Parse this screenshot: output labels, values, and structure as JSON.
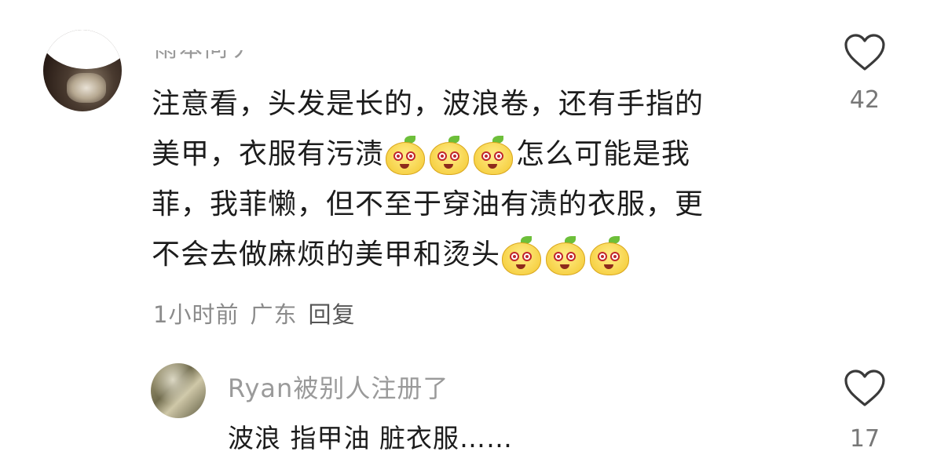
{
  "comment": {
    "username_partial": "雨本问丿",
    "lines": [
      [
        "注意看，头发是长的，波浪卷，还有手指的"
      ],
      [
        "美甲，衣服有污渍",
        "",
        "",
        "",
        "怎么可能是我"
      ],
      [
        "菲，我菲懒，但不至于穿油有渍的衣服，更"
      ],
      [
        "不会去做麻烦的美甲和烫头",
        "",
        "",
        ""
      ]
    ],
    "line1": "注意看，头发是长的，波浪卷，还有手指的",
    "line2a": "美甲，衣服有污渍",
    "line2b": "怎么可能是我",
    "line3": "菲，我菲懒，但不至于穿油有渍的衣服，更",
    "line4": "不会去做麻烦的美甲和烫头",
    "emoji_icon": "pear-mascot-emoji",
    "time": "1小时前",
    "location": "广东",
    "reply_label": "回复",
    "like_count": "42"
  },
  "reply": {
    "username": "Ryan被别人注册了",
    "text": "波浪 指甲油 脏衣服……",
    "like_count": "17"
  },
  "colors": {
    "text": "#1c1c1c",
    "meta": "#8b8b8b",
    "username": "#9a9a9a"
  }
}
